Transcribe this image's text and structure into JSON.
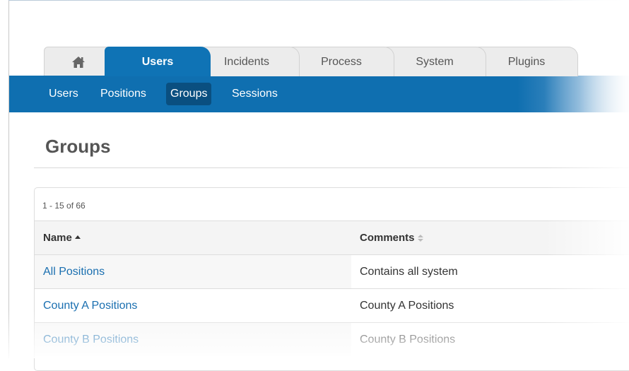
{
  "tabs": {
    "home_icon": "home-icon",
    "users": "Users",
    "incidents": "Incidents",
    "process": "Process",
    "system": "System",
    "plugins": "Plugins",
    "active_color": "#0f73b5"
  },
  "subnav": {
    "items": [
      "Users",
      "Positions",
      "Groups",
      "Sessions"
    ],
    "active": "Groups"
  },
  "page": {
    "title": "Groups"
  },
  "table": {
    "paging": "1 - 15 of 66",
    "columns": [
      "Name",
      "Comments"
    ],
    "rows": [
      {
        "name": "All Positions",
        "comment": "Contains all system"
      },
      {
        "name": "County A Positions",
        "comment": "County A Positions"
      },
      {
        "name": "County B Positions",
        "comment": "County B Positions"
      }
    ],
    "link_color": "#1a6fb0"
  }
}
